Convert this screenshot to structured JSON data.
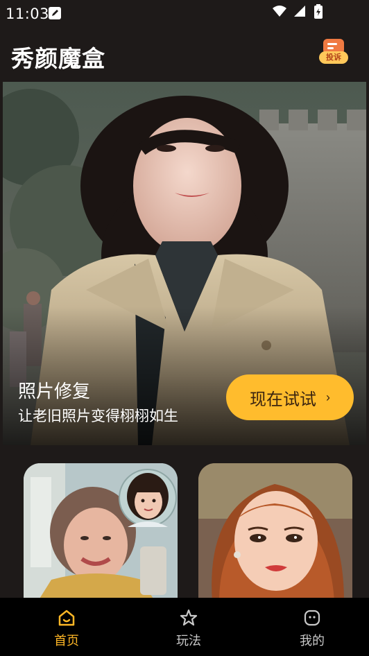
{
  "status_bar": {
    "time": "11:03",
    "icons": [
      "edit-icon",
      "wifi-icon",
      "signal-icon",
      "battery-icon"
    ]
  },
  "header": {
    "app_title": "秀颜魔盒",
    "complaint_label": "投诉",
    "complaint_icon": "chat-icon",
    "complaint_color": "#f07a42"
  },
  "hero": {
    "title": "照片修复",
    "subtitle": "让老旧照片变得栩栩如生",
    "cta_label": "现在试试",
    "cta_chevron": "›",
    "cta_color": "#ffbc2d"
  },
  "cards": [
    {
      "name": "old-photo-to-child-card"
    },
    {
      "name": "cartoon-portrait-card"
    }
  ],
  "bottom_nav": {
    "items": [
      {
        "label": "首页",
        "icon": "home-icon",
        "active": true
      },
      {
        "label": "玩法",
        "icon": "star-icon",
        "active": false
      },
      {
        "label": "我的",
        "icon": "profile-icon",
        "active": false
      }
    ],
    "active_color": "#ffb726",
    "inactive_color": "#c9c9c9"
  }
}
